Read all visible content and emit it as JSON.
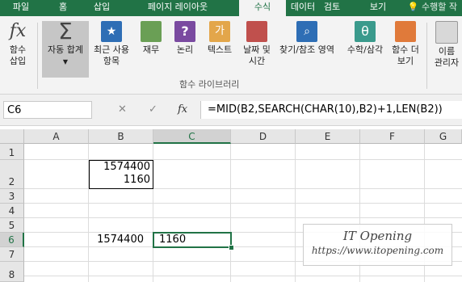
{
  "tabs": [
    "파일",
    "홈",
    "삽입",
    "페이지 레이아웃",
    "수식",
    "데이터",
    "검토",
    "보기"
  ],
  "active_tab": "수식",
  "tell_me": "수행할 작",
  "ribbon": {
    "insert_function": "함수\n삽입",
    "autosum": "자동 합계",
    "recent": "최근 사용\n항목",
    "financial": "재무",
    "logical": "논리",
    "text": "텍스트",
    "datetime": "날짜 및\n시간",
    "lookup": "찾기/참조 영역",
    "math": "수학/삼각",
    "more": "함수 더\n보기",
    "names": "이름\n관리자",
    "group_label": "함수 라이브러리",
    "icons": [
      "fx-icon",
      "sigma-icon",
      "star-book-icon",
      "coins-book-icon",
      "question-book-icon",
      "text-book-icon",
      "calendar-book-icon",
      "magnifier-book-icon",
      "theta-book-icon",
      "more-book-icon",
      "name-manager-icon"
    ]
  },
  "formula_bar": {
    "name_box": "C6",
    "cancel": "✕",
    "enter": "✓",
    "fx": "fx",
    "formula": "=MID(B2,SEARCH(CHAR(10),B2)+1,LEN(B2))"
  },
  "columns": [
    "A",
    "B",
    "C",
    "D",
    "E",
    "F",
    "G"
  ],
  "rows": [
    "1",
    "2",
    "3",
    "4",
    "5",
    "6",
    "7",
    "8"
  ],
  "cells": {
    "B2": "1574400\n1160",
    "B6": "1574400",
    "C6": "1160"
  },
  "watermark": {
    "title": "IT Opening",
    "url": "https://www.itopening.com"
  },
  "colors": {
    "accent": "#217346"
  }
}
